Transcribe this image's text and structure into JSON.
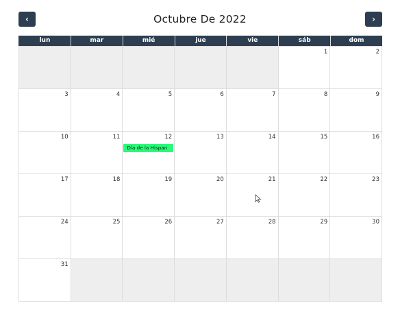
{
  "header": {
    "title": "Octubre De 2022",
    "prev_icon": "chevron-left-icon",
    "next_icon": "chevron-right-icon",
    "prev_glyph": "‹",
    "next_glyph": "›"
  },
  "weekdays": [
    "lun",
    "mar",
    "mié",
    "jue",
    "vie",
    "sáb",
    "dom"
  ],
  "weeks": [
    [
      {
        "n": "",
        "other": true
      },
      {
        "n": "",
        "other": true
      },
      {
        "n": "",
        "other": true
      },
      {
        "n": "",
        "other": true
      },
      {
        "n": "",
        "other": true
      },
      {
        "n": "1"
      },
      {
        "n": "2"
      }
    ],
    [
      {
        "n": "3"
      },
      {
        "n": "4"
      },
      {
        "n": "5"
      },
      {
        "n": "6"
      },
      {
        "n": "7"
      },
      {
        "n": "8"
      },
      {
        "n": "9"
      }
    ],
    [
      {
        "n": "10"
      },
      {
        "n": "11"
      },
      {
        "n": "12",
        "event": "Día de la Hispan"
      },
      {
        "n": "13"
      },
      {
        "n": "14"
      },
      {
        "n": "15"
      },
      {
        "n": "16"
      }
    ],
    [
      {
        "n": "17"
      },
      {
        "n": "18"
      },
      {
        "n": "19"
      },
      {
        "n": "20"
      },
      {
        "n": "21"
      },
      {
        "n": "22"
      },
      {
        "n": "23"
      }
    ],
    [
      {
        "n": "24"
      },
      {
        "n": "25"
      },
      {
        "n": "26"
      },
      {
        "n": "27"
      },
      {
        "n": "28"
      },
      {
        "n": "29"
      },
      {
        "n": "30"
      }
    ],
    [
      {
        "n": "31"
      },
      {
        "n": "",
        "other": true
      },
      {
        "n": "",
        "other": true
      },
      {
        "n": "",
        "other": true
      },
      {
        "n": "",
        "other": true
      },
      {
        "n": "",
        "other": true
      },
      {
        "n": "",
        "other": true
      }
    ]
  ],
  "colors": {
    "header_bg": "#2c3e50",
    "event_bg": "#2bf97a",
    "other_month_bg": "#eeeeee",
    "border": "#dddddd"
  }
}
